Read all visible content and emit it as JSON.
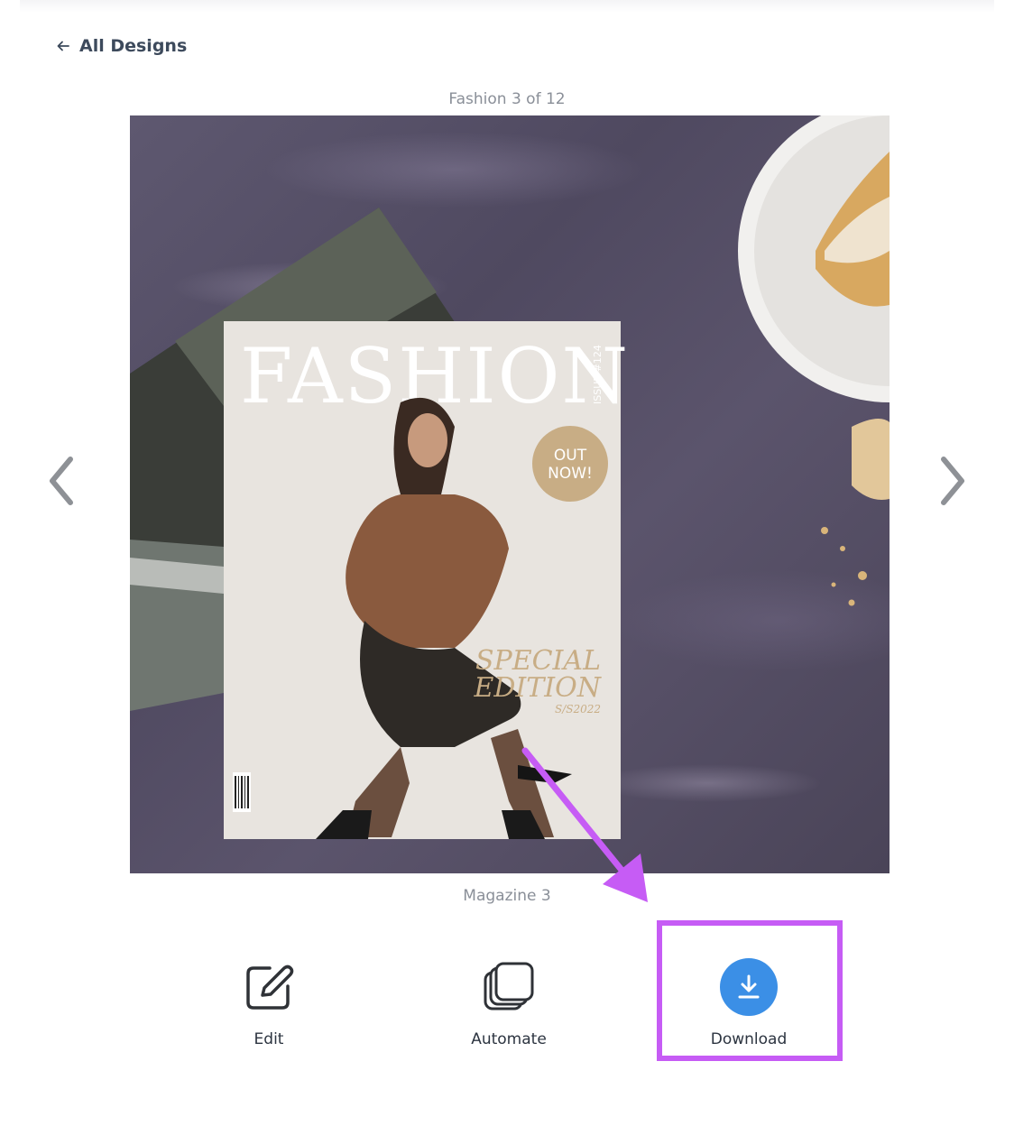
{
  "nav": {
    "back_label": "All Designs"
  },
  "design": {
    "title": "Fashion 3 of 12",
    "name": "Magazine 3",
    "counter": {
      "current": 3,
      "total": 12
    }
  },
  "magazine": {
    "masthead": "FASHION",
    "issue": "ISSUE #124",
    "badge_line1": "OUT",
    "badge_line2": "NOW!",
    "special_line1": "SPECIAL",
    "special_line2": "EDITION",
    "season": "S/S2022"
  },
  "actions": [
    {
      "label": "Edit",
      "icon": "pencil-square-icon"
    },
    {
      "label": "Automate",
      "icon": "stacked-pages-icon"
    },
    {
      "label": "Download",
      "icon": "download-icon"
    }
  ],
  "colors": {
    "accent_blue": "#3b8fe6",
    "highlight_purple": "#c65cf5",
    "badge_gold": "#c8ad85",
    "cover_bg": "#e8e4df"
  }
}
